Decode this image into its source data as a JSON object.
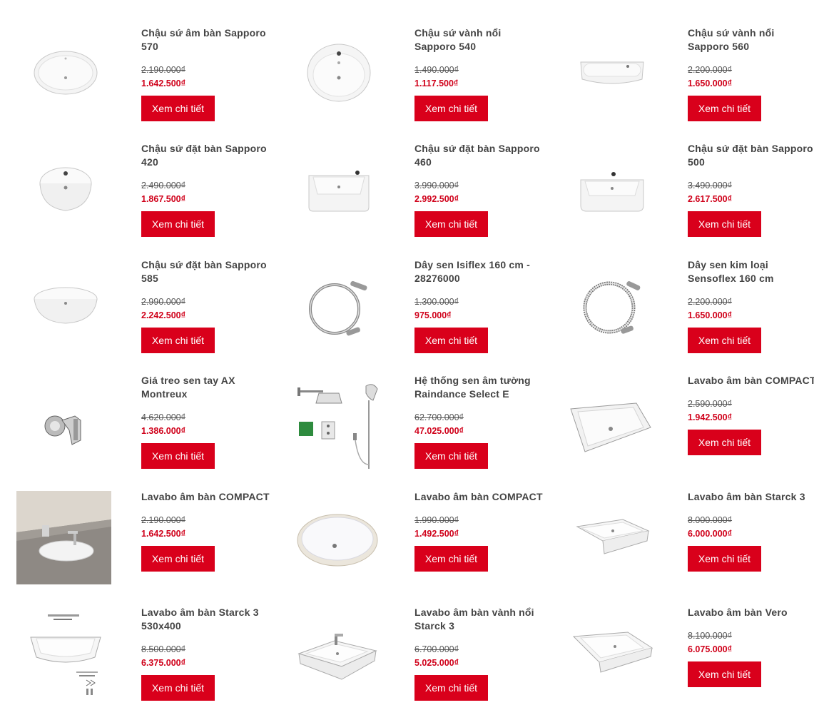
{
  "button_label": "Xem chi tiết",
  "colors": {
    "accent": "#d9001b",
    "price": "#d0021b",
    "title": "#444444"
  },
  "products": [
    {
      "title": "Chậu sứ âm bàn Sapporo 570",
      "old_price": "2.190.000₫",
      "new_price": "1.642.500₫",
      "image": "oval-undermount-basin"
    },
    {
      "title": "Chậu sứ vành nổi Sapporo 540",
      "old_price": "1.490.000₫",
      "new_price": "1.117.500₫",
      "image": "round-rim-basin"
    },
    {
      "title": "Chậu sứ vành nổi Sapporo 560",
      "old_price": "2.200.000₫",
      "new_price": "1.650.000₫",
      "image": "rect-rim-basin"
    },
    {
      "title": "Chậu sứ đặt bàn Sapporo 420",
      "old_price": "2.490.000₫",
      "new_price": "1.867.500₫",
      "image": "round-vessel-basin"
    },
    {
      "title": "Chậu sứ đặt bàn Sapporo 460",
      "old_price": "3.990.000₫",
      "new_price": "2.992.500₫",
      "image": "square-vessel-basin"
    },
    {
      "title": "Chậu sứ đặt bàn Sapporo 500",
      "old_price": "3.490.000₫",
      "new_price": "2.617.500₫",
      "image": "rect-vessel-basin"
    },
    {
      "title": "Chậu sứ đặt bàn Sapporo 585",
      "old_price": "2.990.000₫",
      "new_price": "2.242.500₫",
      "image": "oval-vessel-basin"
    },
    {
      "title": "Dây sen Isiflex 160 cm - 28276000",
      "old_price": "1.300.000₫",
      "new_price": "975.000₫",
      "image": "shower-hose"
    },
    {
      "title": "Dây sen kim loại Sensoflex 160 cm",
      "old_price": "2.200.000₫",
      "new_price": "1.650.000₫",
      "image": "metal-shower-hose"
    },
    {
      "title": "Giá treo sen tay AX Montreux",
      "old_price": "4.620.000₫",
      "new_price": "1.386.000₫",
      "image": "shower-holder"
    },
    {
      "title": "Hệ thống sen âm tường Raindance Select E",
      "old_price": "62.700.000₫",
      "new_price": "47.025.000₫",
      "image": "shower-system"
    },
    {
      "title": "Lavabo âm bàn COMPACT",
      "old_price": "2.590.000₫",
      "new_price": "1.942.500₫",
      "image": "rect-undermount-basin"
    },
    {
      "title": "Lavabo âm bàn COMPACT",
      "old_price": "2.190.000₫",
      "new_price": "1.642.500₫",
      "image": "countertop-photo"
    },
    {
      "title": "Lavabo âm bàn COMPACT",
      "old_price": "1.990.000₫",
      "new_price": "1.492.500₫",
      "image": "oval-undermount-basin-2"
    },
    {
      "title": "Lavabo âm bàn Starck 3",
      "old_price": "8.000.000₫",
      "new_price": "6.000.000₫",
      "image": "starck-undermount-basin"
    },
    {
      "title": "Lavabo âm bàn Starck 3 530x400",
      "old_price": "8.500.000₫",
      "new_price": "6.375.000₫",
      "image": "starck-spec-sheet"
    },
    {
      "title": "Lavabo âm bàn vành nổi Starck 3",
      "old_price": "6.700.000₫",
      "new_price": "5.025.000₫",
      "image": "starck-rim-basin"
    },
    {
      "title": "Lavabo âm bàn Vero",
      "old_price": "8.100.000₫",
      "new_price": "6.075.000₫",
      "image": "vero-undermount-basin"
    }
  ]
}
